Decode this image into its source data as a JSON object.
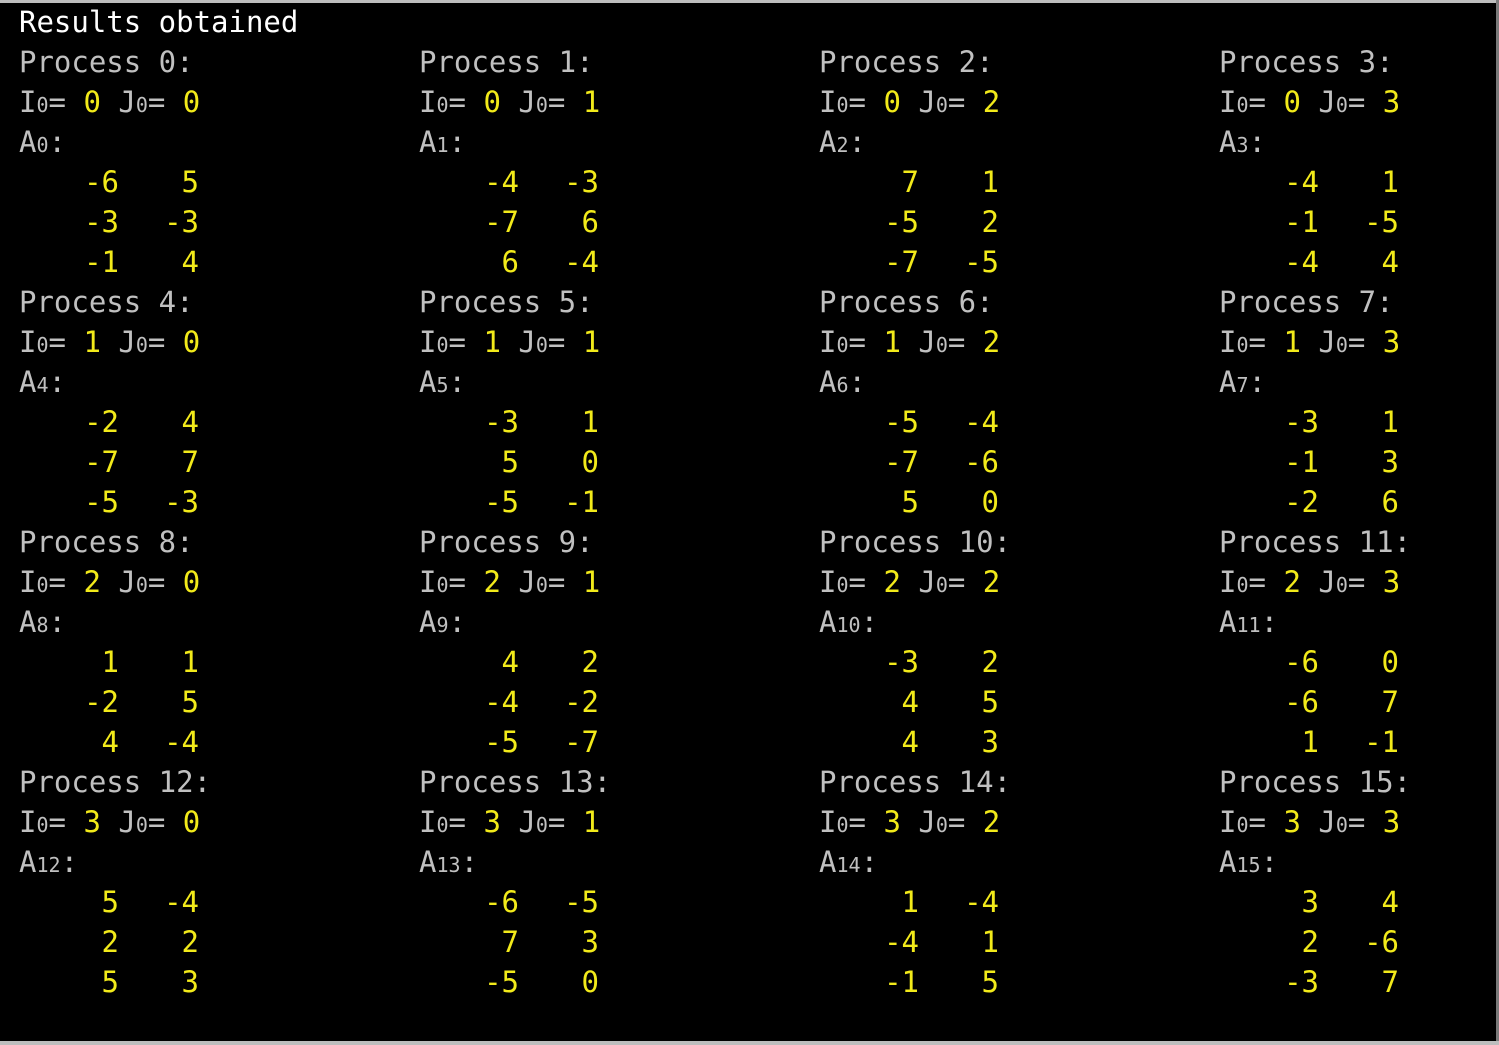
{
  "title": "Results obtained",
  "labels": {
    "process": "Process",
    "colon": ":",
    "i": "I",
    "j": "J",
    "a": "A",
    "idx": "0",
    "eq": "= "
  },
  "colors": {
    "background": "#000000",
    "label": "#c0c0c0",
    "value": "#f2ea1a",
    "title": "#ffffff"
  },
  "processes": [
    {
      "id": "0",
      "i0": "0",
      "j0": "0",
      "matrix": [
        [
          "-6",
          "5"
        ],
        [
          "-3",
          "-3"
        ],
        [
          "-1",
          "4"
        ]
      ]
    },
    {
      "id": "1",
      "i0": "0",
      "j0": "1",
      "matrix": [
        [
          "-4",
          "-3"
        ],
        [
          "-7",
          "6"
        ],
        [
          "6",
          "-4"
        ]
      ]
    },
    {
      "id": "2",
      "i0": "0",
      "j0": "2",
      "matrix": [
        [
          "7",
          "1"
        ],
        [
          "-5",
          "2"
        ],
        [
          "-7",
          "-5"
        ]
      ]
    },
    {
      "id": "3",
      "i0": "0",
      "j0": "3",
      "matrix": [
        [
          "-4",
          "1"
        ],
        [
          "-1",
          "-5"
        ],
        [
          "-4",
          "4"
        ]
      ]
    },
    {
      "id": "4",
      "i0": "1",
      "j0": "0",
      "matrix": [
        [
          "-2",
          "4"
        ],
        [
          "-7",
          "7"
        ],
        [
          "-5",
          "-3"
        ]
      ]
    },
    {
      "id": "5",
      "i0": "1",
      "j0": "1",
      "matrix": [
        [
          "-3",
          "1"
        ],
        [
          "5",
          "0"
        ],
        [
          "-5",
          "-1"
        ]
      ]
    },
    {
      "id": "6",
      "i0": "1",
      "j0": "2",
      "matrix": [
        [
          "-5",
          "-4"
        ],
        [
          "-7",
          "-6"
        ],
        [
          "5",
          "0"
        ]
      ]
    },
    {
      "id": "7",
      "i0": "1",
      "j0": "3",
      "matrix": [
        [
          "-3",
          "1"
        ],
        [
          "-1",
          "3"
        ],
        [
          "-2",
          "6"
        ]
      ]
    },
    {
      "id": "8",
      "i0": "2",
      "j0": "0",
      "matrix": [
        [
          "1",
          "1"
        ],
        [
          "-2",
          "5"
        ],
        [
          "4",
          "-4"
        ]
      ]
    },
    {
      "id": "9",
      "i0": "2",
      "j0": "1",
      "matrix": [
        [
          "4",
          "2"
        ],
        [
          "-4",
          "-2"
        ],
        [
          "-5",
          "-7"
        ]
      ]
    },
    {
      "id": "10",
      "i0": "2",
      "j0": "2",
      "matrix": [
        [
          "-3",
          "2"
        ],
        [
          "4",
          "5"
        ],
        [
          "4",
          "3"
        ]
      ]
    },
    {
      "id": "11",
      "i0": "2",
      "j0": "3",
      "matrix": [
        [
          "-6",
          "0"
        ],
        [
          "-6",
          "7"
        ],
        [
          "1",
          "-1"
        ]
      ]
    },
    {
      "id": "12",
      "i0": "3",
      "j0": "0",
      "matrix": [
        [
          "5",
          "-4"
        ],
        [
          "2",
          "2"
        ],
        [
          "5",
          "3"
        ]
      ]
    },
    {
      "id": "13",
      "i0": "3",
      "j0": "1",
      "matrix": [
        [
          "-6",
          "-5"
        ],
        [
          "7",
          "3"
        ],
        [
          "-5",
          "0"
        ]
      ]
    },
    {
      "id": "14",
      "i0": "3",
      "j0": "2",
      "matrix": [
        [
          "1",
          "-4"
        ],
        [
          "-4",
          "1"
        ],
        [
          "-1",
          "5"
        ]
      ]
    },
    {
      "id": "15",
      "i0": "3",
      "j0": "3",
      "matrix": [
        [
          "3",
          "4"
        ],
        [
          "2",
          "-6"
        ],
        [
          "-3",
          "7"
        ]
      ]
    }
  ]
}
